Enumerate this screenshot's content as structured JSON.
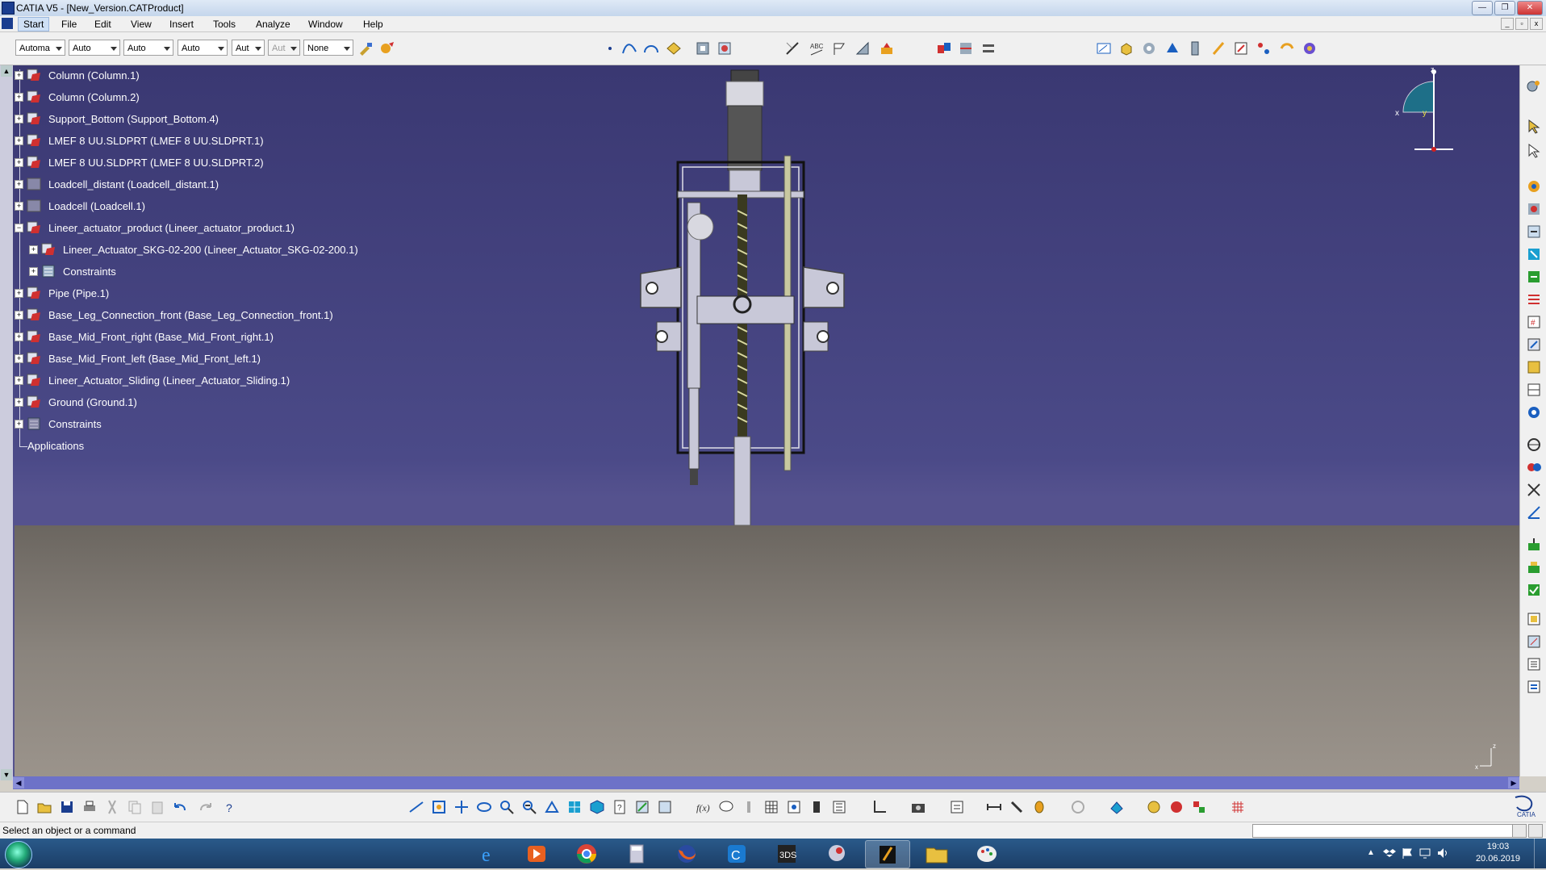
{
  "window": {
    "title": "CATIA V5 - [New_Version.CATProduct]"
  },
  "menu": [
    {
      "label": "Start"
    },
    {
      "label": "File"
    },
    {
      "label": "Edit"
    },
    {
      "label": "View"
    },
    {
      "label": "Insert"
    },
    {
      "label": "Tools"
    },
    {
      "label": "Analyze"
    },
    {
      "label": "Window"
    },
    {
      "label": "Help"
    }
  ],
  "toolbar": {
    "combos": [
      {
        "value": "Automa"
      },
      {
        "value": "Auto"
      },
      {
        "value": "Auto"
      },
      {
        "value": "Auto"
      },
      {
        "value": "Aut"
      },
      {
        "value": "Aut"
      },
      {
        "value": "None"
      }
    ]
  },
  "tree": {
    "nodes": [
      {
        "label": "Column (Column.1)"
      },
      {
        "label": "Column (Column.2)"
      },
      {
        "label": "Support_Bottom (Support_Bottom.4)"
      },
      {
        "label": "LMEF 8 UU.SLDPRT (LMEF 8 UU.SLDPRT.1)"
      },
      {
        "label": "LMEF 8 UU.SLDPRT (LMEF 8 UU.SLDPRT.2)"
      },
      {
        "label": "Loadcell_distant (Loadcell_distant.1)"
      },
      {
        "label": "Loadcell (Loadcell.1)"
      },
      {
        "label": "Lineer_actuator_product (Lineer_actuator_product.1)"
      },
      {
        "label": "Lineer_Actuator_SKG-02-200 (Lineer_Actuator_SKG-02-200.1)"
      },
      {
        "label": "Constraints"
      },
      {
        "label": "Pipe (Pipe.1)"
      },
      {
        "label": "Base_Leg_Connection_front (Base_Leg_Connection_front.1)"
      },
      {
        "label": "Base_Mid_Front_right (Base_Mid_Front_right.1)"
      },
      {
        "label": "Base_Mid_Front_left (Base_Mid_Front_left.1)"
      },
      {
        "label": "Lineer_Actuator_Sliding (Lineer_Actuator_Sliding.1)"
      },
      {
        "label": "Ground (Ground.1)"
      },
      {
        "label": "Constraints"
      },
      {
        "label": "Applications"
      }
    ]
  },
  "compass": {
    "x_label": "x",
    "y_label": "y",
    "z_label": "z"
  },
  "axis_small": {
    "x_label": "x",
    "z_label": "z"
  },
  "status": {
    "message": "Select an object or a command"
  },
  "clock": {
    "time": "19:03",
    "date": "20.06.2019"
  },
  "colors": {
    "background_top": "#3a3872",
    "ground": "#8a847d",
    "tree_text": "#ffffff"
  }
}
